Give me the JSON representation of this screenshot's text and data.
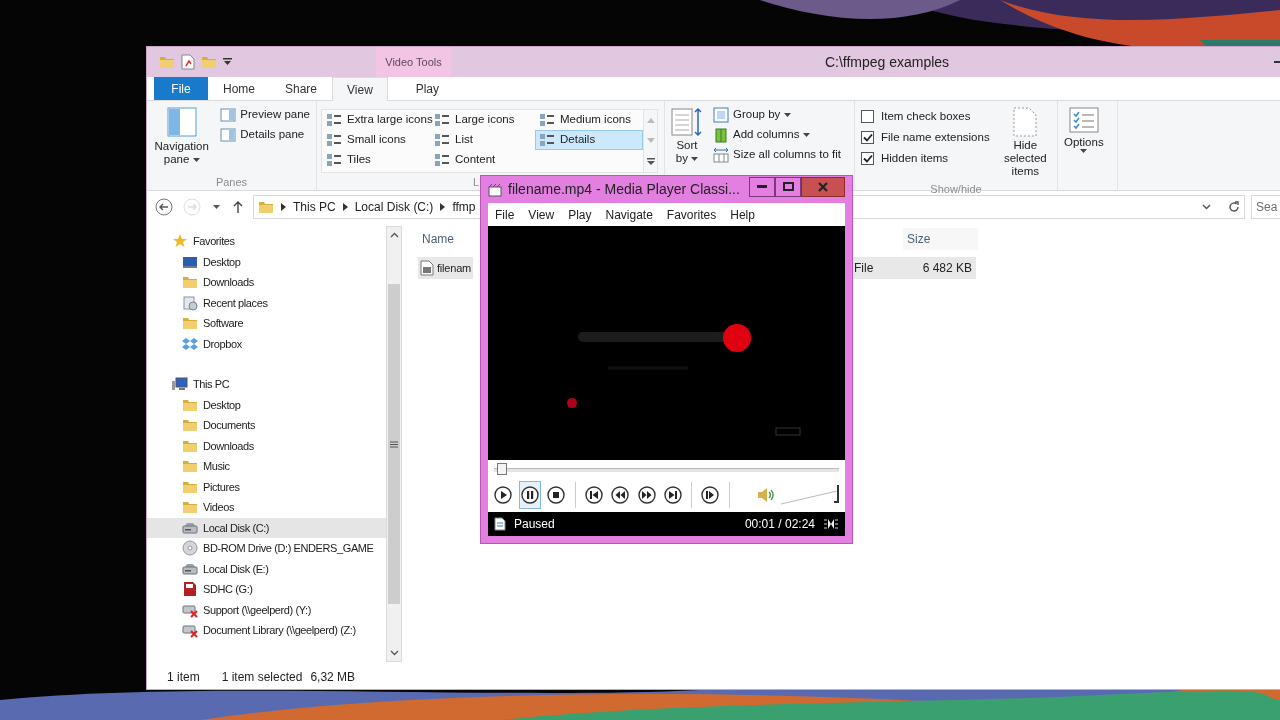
{
  "explorer": {
    "title": "C:\\ffmpeg examples",
    "context_label": "Video Tools",
    "tabs": [
      {
        "label": "File",
        "kind": "file",
        "selected": false
      },
      {
        "label": "Home",
        "kind": "tab",
        "selected": false
      },
      {
        "label": "Share",
        "kind": "tab",
        "selected": false
      },
      {
        "label": "View",
        "kind": "tab",
        "selected": true
      },
      {
        "label": "Play",
        "kind": "context",
        "selected": false
      }
    ],
    "panes": {
      "label": "Panes",
      "navigation": "Navigation pane",
      "items": [
        "Preview pane",
        "Details pane"
      ]
    },
    "layout": {
      "label": "L",
      "items": [
        {
          "label": "Extra large icons",
          "selected": false
        },
        {
          "label": "Large icons",
          "selected": false
        },
        {
          "label": "Medium icons",
          "selected": false
        },
        {
          "label": "Small icons",
          "selected": false
        },
        {
          "label": "List",
          "selected": false
        },
        {
          "label": "Details",
          "selected": true
        },
        {
          "label": "Tiles",
          "selected": false
        },
        {
          "label": "Content",
          "selected": false
        }
      ]
    },
    "current_view": {
      "sort": "Sort by",
      "items": [
        {
          "label": "Group by",
          "kind": "group"
        },
        {
          "label": "Add columns",
          "kind": "columns"
        },
        {
          "label": "Size all columns to fit",
          "kind": "fit"
        }
      ]
    },
    "show_hide": {
      "label": "Show/hide",
      "checkboxes": [
        {
          "label": "Item check boxes",
          "checked": false
        },
        {
          "label": "File name extensions",
          "checked": true
        },
        {
          "label": "Hidden items",
          "checked": true
        }
      ],
      "hide_selected": "Hide selected items"
    },
    "options": "Options",
    "breadcrumb": [
      "This PC",
      "Local Disk (C:)",
      "ffmp"
    ],
    "search": {
      "placeholder": "Sea"
    },
    "nav": [
      {
        "label": "Favorites",
        "kind": "star",
        "selected": false,
        "children": [
          {
            "label": "Desktop",
            "kind": "desktop",
            "selected": false
          },
          {
            "label": "Downloads",
            "kind": "folder",
            "selected": false
          },
          {
            "label": "Recent places",
            "kind": "recent",
            "selected": false
          },
          {
            "label": "Software",
            "kind": "folder",
            "selected": false
          },
          {
            "label": "Dropbox",
            "kind": "dropbox",
            "selected": false
          }
        ]
      },
      {
        "label": "This PC",
        "kind": "computer",
        "selected": false,
        "children": [
          {
            "label": "Desktop",
            "kind": "folder",
            "selected": false
          },
          {
            "label": "Documents",
            "kind": "folder",
            "selected": false
          },
          {
            "label": "Downloads",
            "kind": "folder",
            "selected": false
          },
          {
            "label": "Music",
            "kind": "folder",
            "selected": false
          },
          {
            "label": "Pictures",
            "kind": "folder",
            "selected": false
          },
          {
            "label": "Videos",
            "kind": "folder",
            "selected": false
          },
          {
            "label": "Local Disk (C:)",
            "kind": "drive",
            "selected": true
          },
          {
            "label": "BD-ROM Drive (D:) ENDERS_GAME",
            "kind": "disc",
            "selected": false
          },
          {
            "label": "Local Disk (E:)",
            "kind": "drive",
            "selected": false
          },
          {
            "label": "SDHC (G:)",
            "kind": "sd",
            "selected": false
          },
          {
            "label": "Support (\\\\geelperd) (Y:)",
            "kind": "network",
            "selected": false
          },
          {
            "label": "Document Library (\\\\geelperd) (Z:)",
            "kind": "network",
            "selected": false
          }
        ]
      }
    ],
    "columns": {
      "name": "Name",
      "size": "Size"
    },
    "files": [
      {
        "name": "filenam",
        "type": "File",
        "size": "6 482 KB",
        "selected": true
      }
    ],
    "status": {
      "count": "1 item",
      "selection": "1 item selected",
      "size": "6,32 MB"
    }
  },
  "player": {
    "title": "filename.mp4 - Media Player Classi...",
    "menu": [
      "File",
      "View",
      "Play",
      "Navigate",
      "Favorites",
      "Help"
    ],
    "seek": {
      "level": 0.01
    },
    "controls": [
      {
        "kind": "play",
        "selected": false
      },
      {
        "kind": "pause",
        "selected": true
      },
      {
        "kind": "stop",
        "selected": false
      },
      {
        "kind": "prev",
        "selected": false
      },
      {
        "kind": "rewind",
        "selected": false
      },
      {
        "kind": "forward",
        "selected": false
      },
      {
        "kind": "next",
        "selected": false
      },
      {
        "kind": "step",
        "selected": false
      }
    ],
    "volume": {
      "level": 1
    },
    "status": "Paused",
    "time": "00:01 / 02:24"
  }
}
